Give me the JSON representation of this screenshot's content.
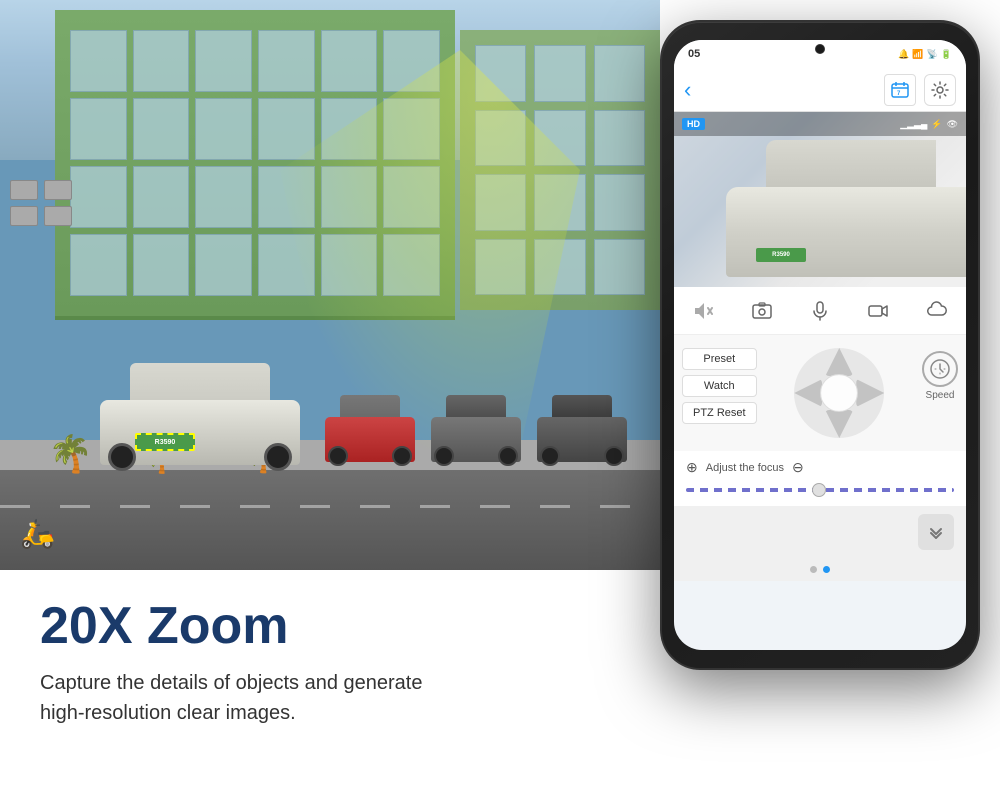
{
  "photo": {
    "alt": "Street scene with cars and building"
  },
  "zoom": {
    "title": "20X Zoom",
    "description_line1": "Capture the details of objects and generate",
    "description_line2": "high-resolution clear images."
  },
  "phone": {
    "status_time": "05",
    "hd_label": "HD",
    "camera_plate": "R3590",
    "ptz_buttons": {
      "preset": "Preset",
      "watch": "Watch",
      "ptz_reset": "PTZ Reset"
    },
    "focus_label": "Adjust the focus",
    "speed_label": "Speed",
    "page_dots": [
      "inactive",
      "active"
    ]
  },
  "icons": {
    "back": "‹",
    "calendar": "📅",
    "settings": "⚙",
    "signal": "📶",
    "mute": "🔇",
    "camera_snap": "📷",
    "mic": "🎤",
    "record": "🎥",
    "cloud": "☁",
    "up_arrow": "▲",
    "down_arrow": "▼",
    "left_arrow": "◀",
    "right_arrow": "▶",
    "double_down": "⌄⌄",
    "zoom_in": "⊕",
    "zoom_out": "⊖"
  },
  "colors": {
    "accent": "#2196F3",
    "title_blue": "#1a3a6a",
    "green_plate": "#4a9a4a"
  }
}
